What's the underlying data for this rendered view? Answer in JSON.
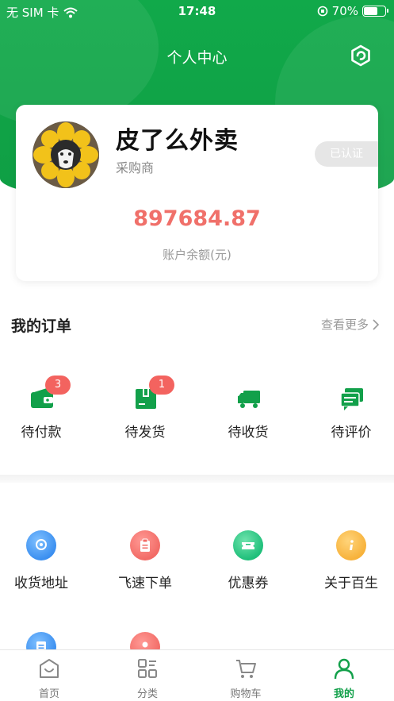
{
  "status_bar": {
    "carrier": "无 SIM 卡",
    "time": "17:48",
    "battery_text": "70%",
    "battery_level": 0.7
  },
  "header": {
    "title": "个人中心",
    "settings_icon": "settings-hexagon-icon"
  },
  "profile": {
    "name": "皮了么外卖",
    "role": "采购商",
    "verified_label": "已认证",
    "balance": "897684.87",
    "balance_label": "账户余额(元)"
  },
  "orders": {
    "title": "我的订单",
    "more_label": "查看更多",
    "items": [
      {
        "label": "待付款",
        "icon": "wallet-icon",
        "badge": "3"
      },
      {
        "label": "待发货",
        "icon": "package-box-icon",
        "badge": "1"
      },
      {
        "label": "待收货",
        "icon": "delivery-truck-icon",
        "badge": ""
      },
      {
        "label": "待评价",
        "icon": "review-chat-icon",
        "badge": ""
      }
    ]
  },
  "services": {
    "items": [
      {
        "label": "收货地址",
        "icon": "location-pin-icon",
        "color": "#3b8ff0"
      },
      {
        "label": "飞速下单",
        "icon": "clipboard-icon",
        "color": "#f26b66"
      },
      {
        "label": "优惠券",
        "icon": "coupon-ticket-icon",
        "color": "#1fbf7a"
      },
      {
        "label": "关于百生",
        "icon": "info-icon",
        "color": "#f7b23b"
      }
    ],
    "partial_row": [
      {
        "icon": "document-icon",
        "color": "#3b8ff0"
      },
      {
        "icon": "person-icon",
        "color": "#f26b66"
      }
    ]
  },
  "tabbar": {
    "items": [
      {
        "label": "首页",
        "icon": "home-icon",
        "active": false
      },
      {
        "label": "分类",
        "icon": "category-grid-icon",
        "active": false
      },
      {
        "label": "购物车",
        "icon": "cart-icon",
        "active": false
      },
      {
        "label": "我的",
        "icon": "user-profile-icon",
        "active": true
      }
    ]
  },
  "colors": {
    "brand_green": "#12a04a",
    "balance_red": "#f0706a",
    "badge_red": "#f3635f"
  }
}
